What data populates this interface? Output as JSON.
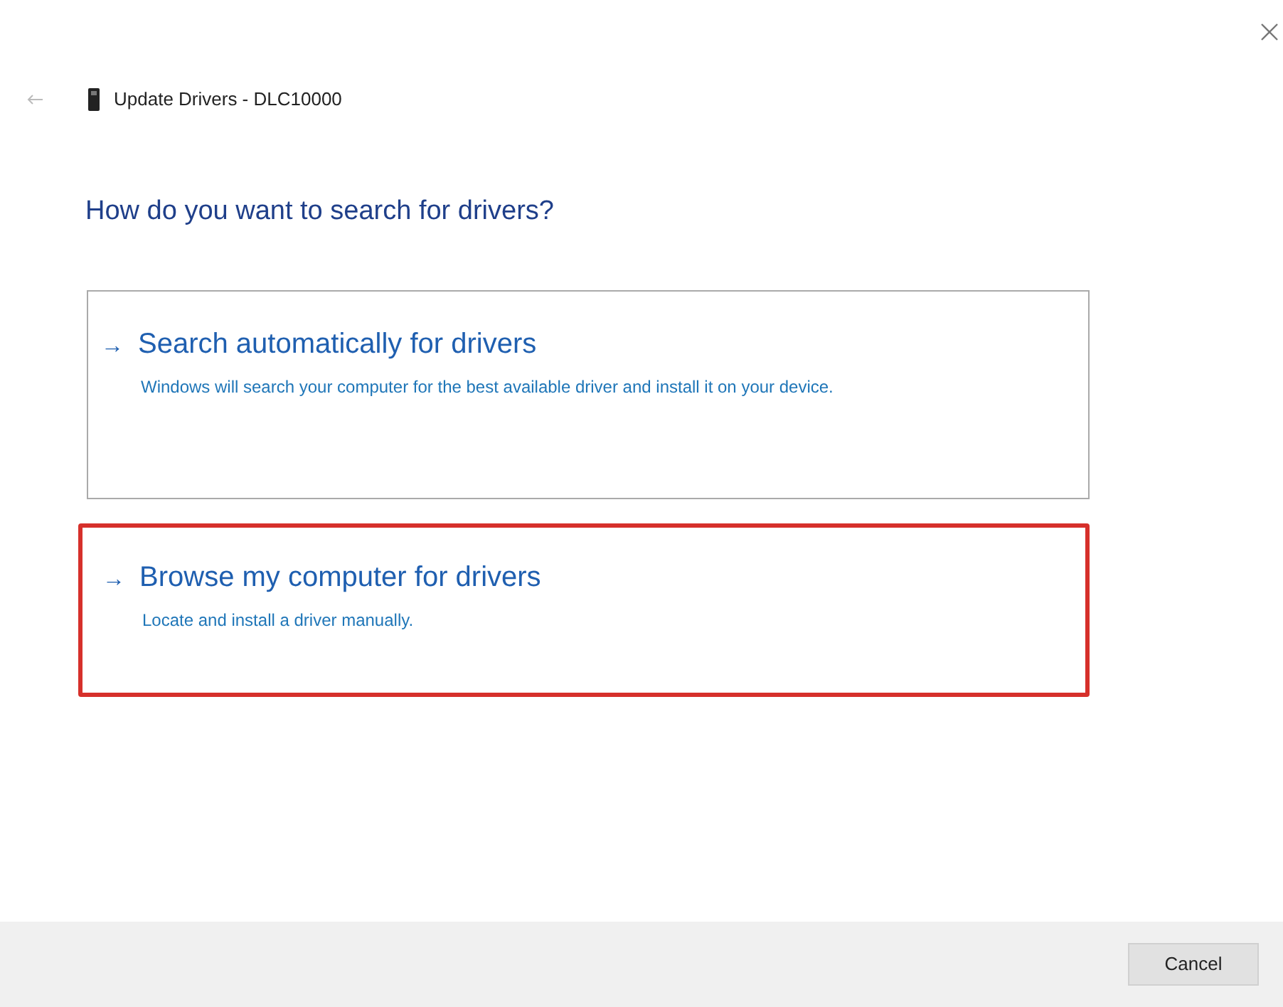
{
  "window": {
    "title": "Update Drivers - DLC10000"
  },
  "heading": "How do you want to search for drivers?",
  "options": [
    {
      "arrow": "→",
      "title": "Search automatically for drivers",
      "description": "Windows will search your computer for the best available driver and install it on your device.",
      "highlighted": false
    },
    {
      "arrow": "→",
      "title": "Browse my computer for drivers",
      "description": "Locate and install a driver manually.",
      "highlighted": true
    }
  ],
  "buttons": [
    "Cancel"
  ]
}
